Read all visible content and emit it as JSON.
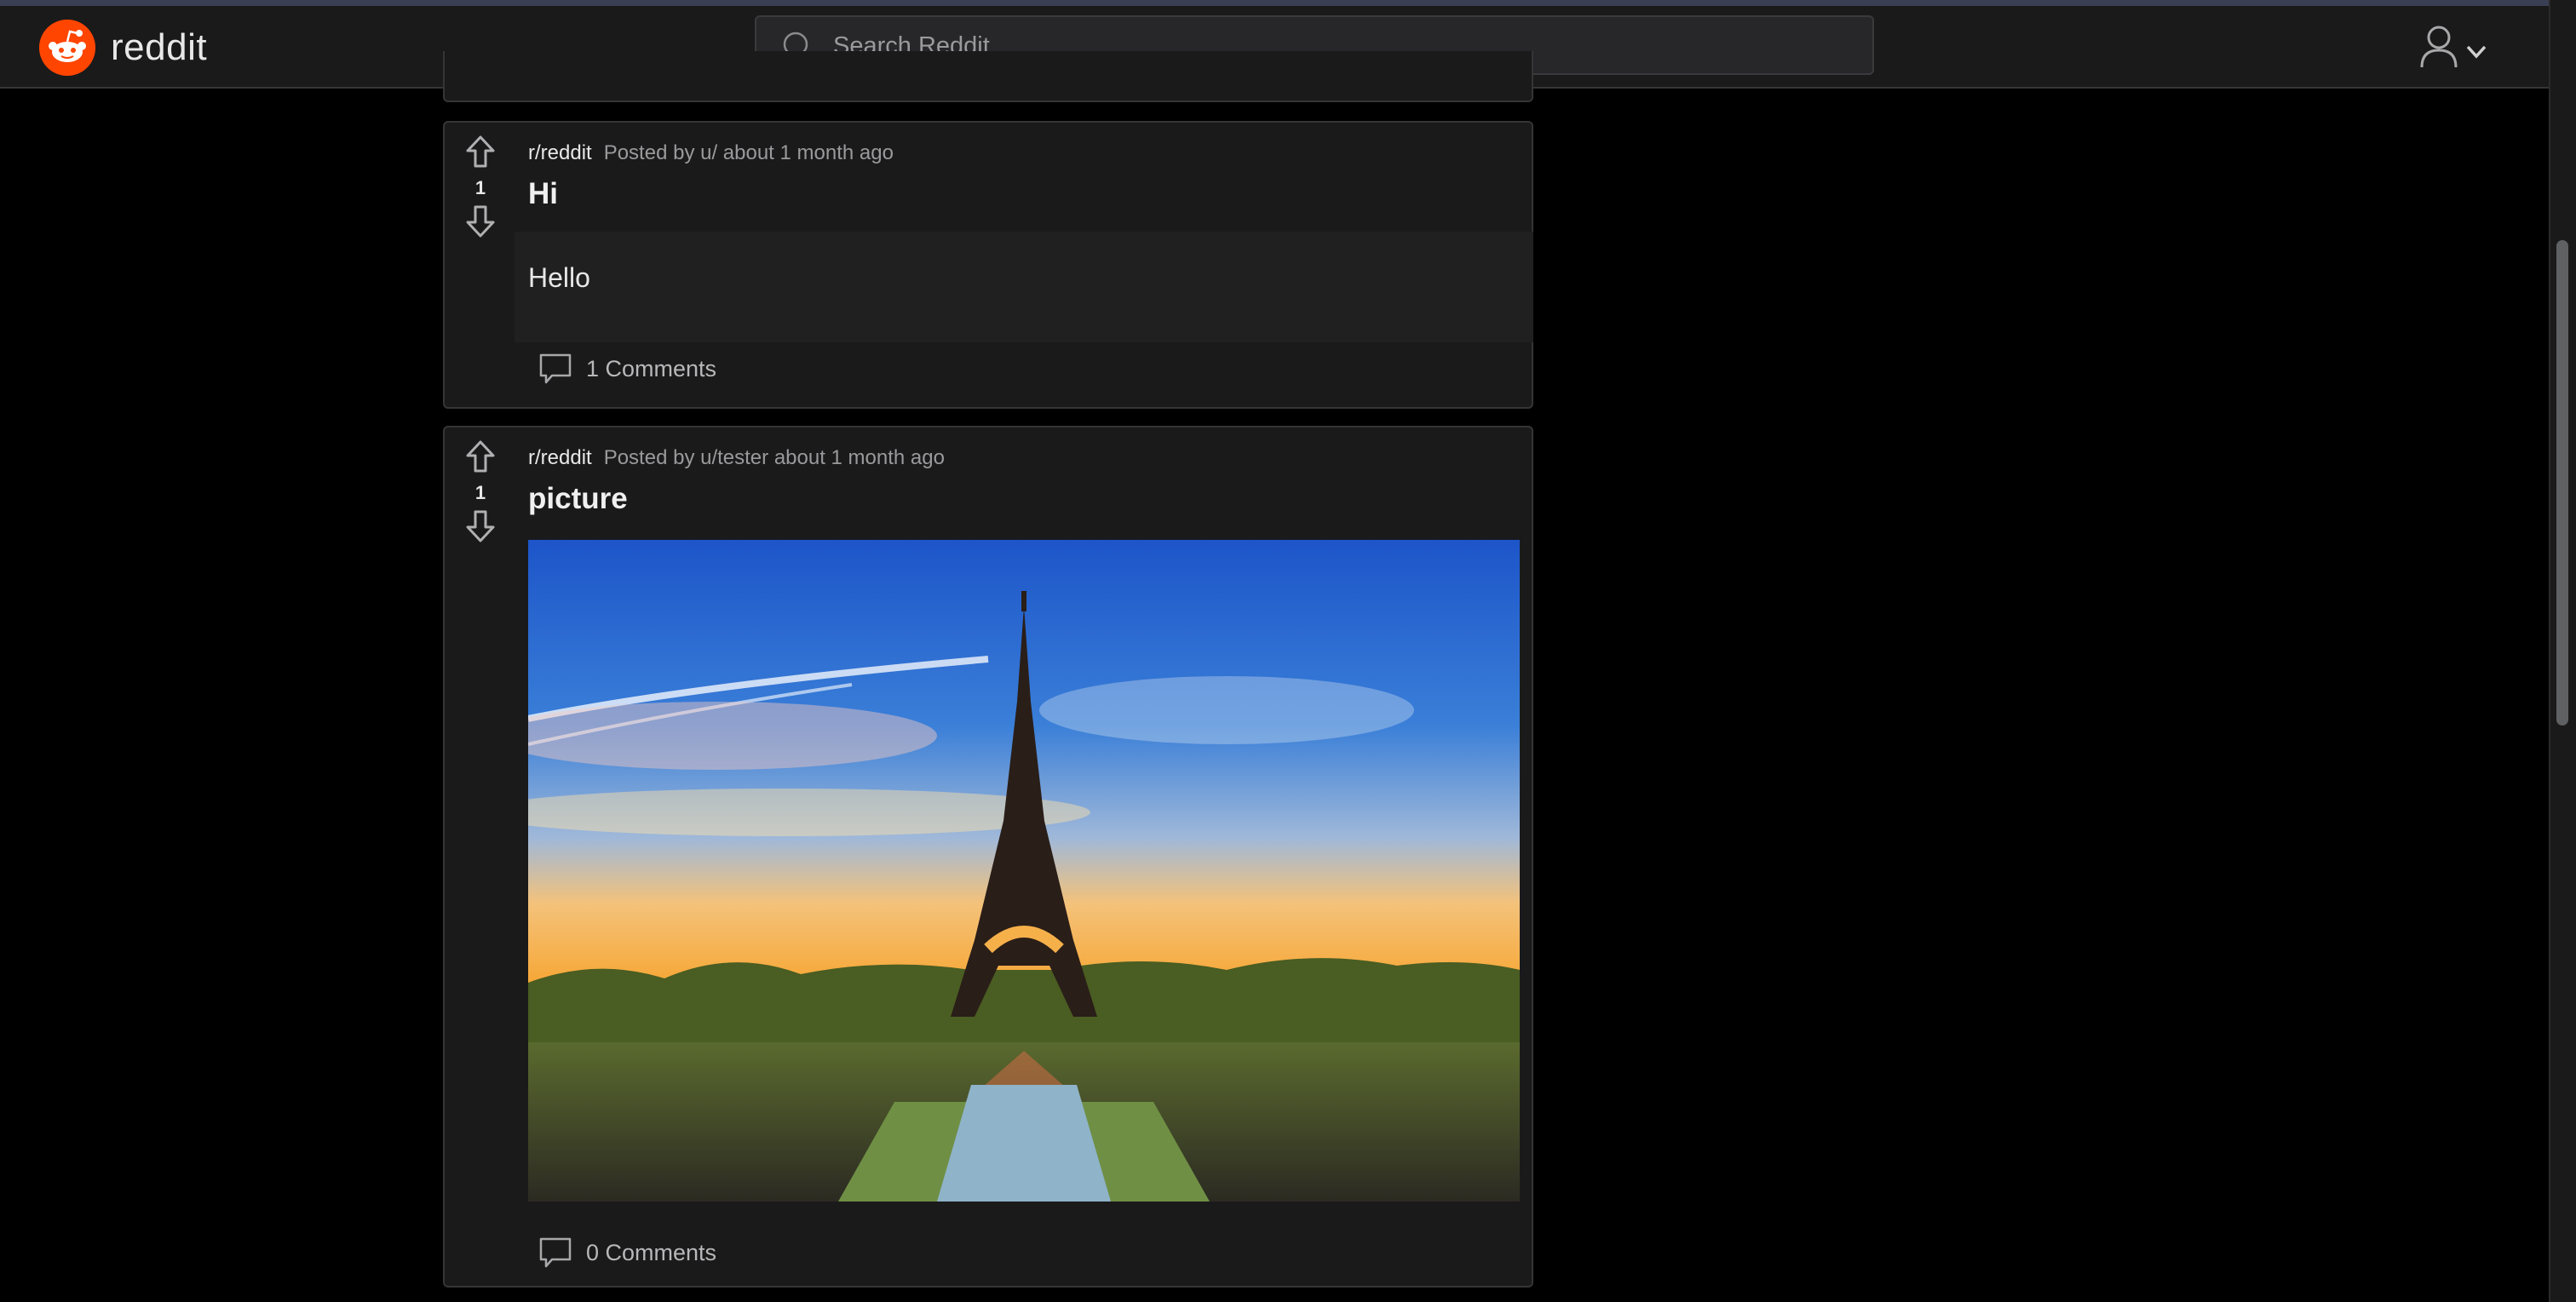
{
  "app": {
    "name": "reddit",
    "brand_color": "#ff4500"
  },
  "search": {
    "placeholder": "Search Reddit"
  },
  "posts": [
    {
      "subreddit": "r/reddit",
      "posted_by": "Posted by u/ about 1 month ago",
      "score": "1",
      "title": "Hi",
      "body": "Hello",
      "comments": "1 Comments"
    },
    {
      "subreddit": "r/reddit",
      "posted_by": "Posted by u/tester about 1 month ago",
      "score": "1",
      "title": "picture",
      "image": "Eiffel Tower at sunset",
      "comments": "0 Comments"
    }
  ],
  "icons": [
    "search-icon",
    "user-icon",
    "chevron-down-icon",
    "upvote-icon",
    "downvote-icon",
    "comment-icon",
    "reddit-logo-icon"
  ]
}
